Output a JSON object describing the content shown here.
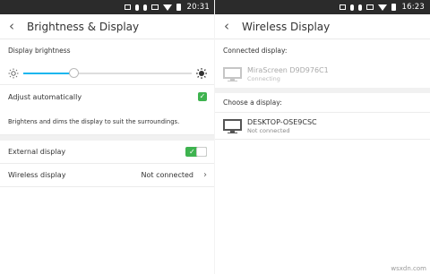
{
  "left": {
    "status_time": "20:31",
    "title": "Brightness & Display",
    "display_brightness_label": "Display brightness",
    "brightness_level": 0.3,
    "adjust_auto_label": "Adjust automatically",
    "adjust_auto_checked": true,
    "adjust_auto_hint": "Brightens and dims the display to suit the surroundings.",
    "external_display_label": "External display",
    "external_display_on": true,
    "wireless_display_label": "Wireless display",
    "wireless_display_value": "Not connected"
  },
  "right": {
    "status_time": "16:23",
    "title": "Wireless Display",
    "connected_section_label": "Connected display:",
    "connected_device": {
      "name": "MiraScreen D9D976C1",
      "status": "Connecting"
    },
    "choose_section_label": "Choose a display:",
    "devices": [
      {
        "name": "DESKTOP-OSE9CSC",
        "status": "Not connected"
      }
    ]
  },
  "watermark": "wsxdn.com",
  "icons": {
    "back": "back-chevron-icon",
    "brightness_low": "sun-small-icon",
    "brightness_high": "sun-large-icon",
    "row_chevron": "chevron-right-icon",
    "monitor": "monitor-icon"
  },
  "colors": {
    "accent_blue": "#19b6ee",
    "toggle_green": "#3eb34f",
    "status_bar": "#2b2b2b"
  }
}
